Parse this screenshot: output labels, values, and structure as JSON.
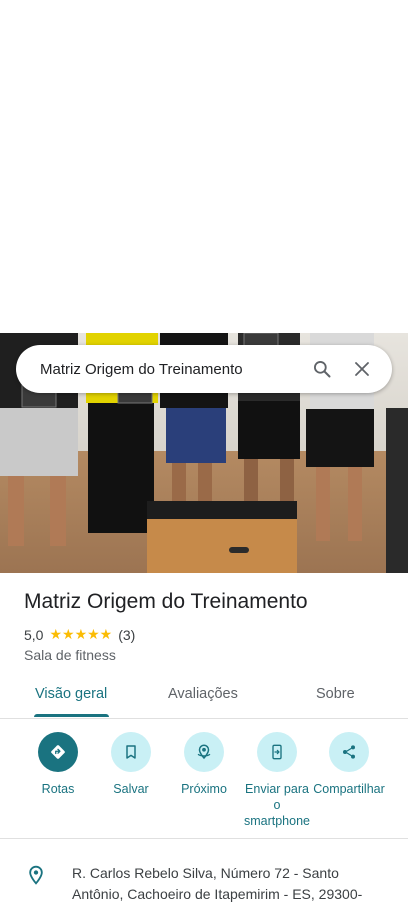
{
  "search": {
    "query": "Matriz Origem do Treinamento"
  },
  "place": {
    "name": "Matriz Origem do Treinamento",
    "rating": "5,0",
    "stars": "★★★★★",
    "review_count": "(3)",
    "category": "Sala de fitness"
  },
  "tabs": [
    {
      "label": "Visão geral",
      "active": true
    },
    {
      "label": "Avaliações",
      "active": false
    },
    {
      "label": "Sobre",
      "active": false
    }
  ],
  "actions": [
    {
      "label": "Rotas",
      "icon": "directions-icon"
    },
    {
      "label": "Salvar",
      "icon": "bookmark-icon"
    },
    {
      "label": "Próximo",
      "icon": "nearby-icon"
    },
    {
      "label": "Enviar para o smartphone",
      "icon": "send-to-phone-icon"
    },
    {
      "label": "Compartilhar",
      "icon": "share-icon"
    }
  ],
  "address": {
    "line": "R. Carlos Rebelo Silva, Número 72 - Santo Antônio, Cachoeiro de Itapemirim - ES, 29300-"
  },
  "colors": {
    "accent": "#1a7380",
    "accent_light": "#c9f0f5",
    "star": "#fbbc04"
  }
}
